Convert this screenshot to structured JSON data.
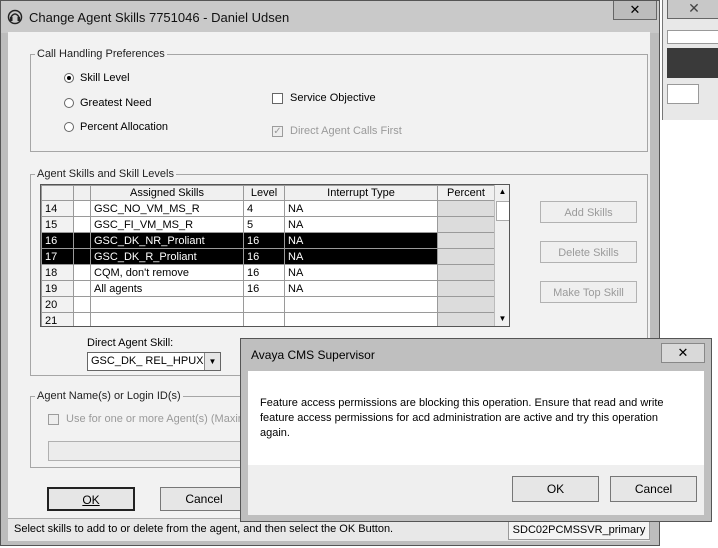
{
  "main_window": {
    "title": "Change Agent Skills 7751046 - Daniel Udsen",
    "close_label": "✕"
  },
  "call_handling": {
    "legend": "Call Handling Preferences",
    "options": [
      {
        "label": "Skill Level",
        "selected": true
      },
      {
        "label": "Greatest Need",
        "selected": false
      },
      {
        "label": "Percent Allocation",
        "selected": false
      }
    ],
    "service_objective_label": "Service Objective",
    "direct_agent_calls_first_label": "Direct Agent Calls First"
  },
  "skills": {
    "legend": "Agent Skills and Skill Levels",
    "columns": [
      "",
      "",
      "Assigned Skills",
      "Level",
      "Interrupt Type",
      "Percent"
    ],
    "rows": [
      {
        "num": "14",
        "skill": "GSC_NO_VM_MS_R",
        "level": "4",
        "interrupt": "NA",
        "percent": "",
        "selected": false
      },
      {
        "num": "15",
        "skill": "GSC_FI_VM_MS_R",
        "level": "5",
        "interrupt": "NA",
        "percent": "",
        "selected": false
      },
      {
        "num": "16",
        "skill": "GSC_DK_NR_Proliant",
        "level": "16",
        "interrupt": "NA",
        "percent": "",
        "selected": true
      },
      {
        "num": "17",
        "skill": "GSC_DK_R_Proliant",
        "level": "16",
        "interrupt": "NA",
        "percent": "",
        "selected": true
      },
      {
        "num": "18",
        "skill": "CQM, don't remove",
        "level": "16",
        "interrupt": "NA",
        "percent": "",
        "selected": false
      },
      {
        "num": "19",
        "skill": "All agents",
        "level": "16",
        "interrupt": "NA",
        "percent": "",
        "selected": false
      },
      {
        "num": "20",
        "skill": "",
        "level": "",
        "interrupt": "",
        "percent": "",
        "selected": false
      },
      {
        "num": "21",
        "skill": "",
        "level": "",
        "interrupt": "",
        "percent": "",
        "selected": false
      }
    ],
    "add_label": "Add Skills",
    "delete_label": "Delete Skills",
    "make_top_label": "Make Top Skill",
    "direct_agent_skill_label": "Direct Agent Skill:",
    "direct_agent_skill_value": "GSC_DK_ REL_HPUX"
  },
  "agents": {
    "legend": "Agent Name(s) or Login ID(s)",
    "use_label": "Use for one or more Agent(s)  (Maxim"
  },
  "buttons": {
    "ok": "OK",
    "cancel": "Cancel"
  },
  "status": {
    "message": "Select skills to add to or delete from the agent, and then select the OK Button.",
    "server": "SDC02PCMSSVR_primary"
  },
  "dialog": {
    "title": "Avaya CMS Supervisor",
    "close_label": "✕",
    "message": "Feature access permissions are blocking this operation.  Ensure that read and write feature access permissions for acd administration are active and try this operation again.",
    "ok": "OK",
    "cancel": "Cancel"
  },
  "background_window": {
    "close_label": "✕"
  }
}
